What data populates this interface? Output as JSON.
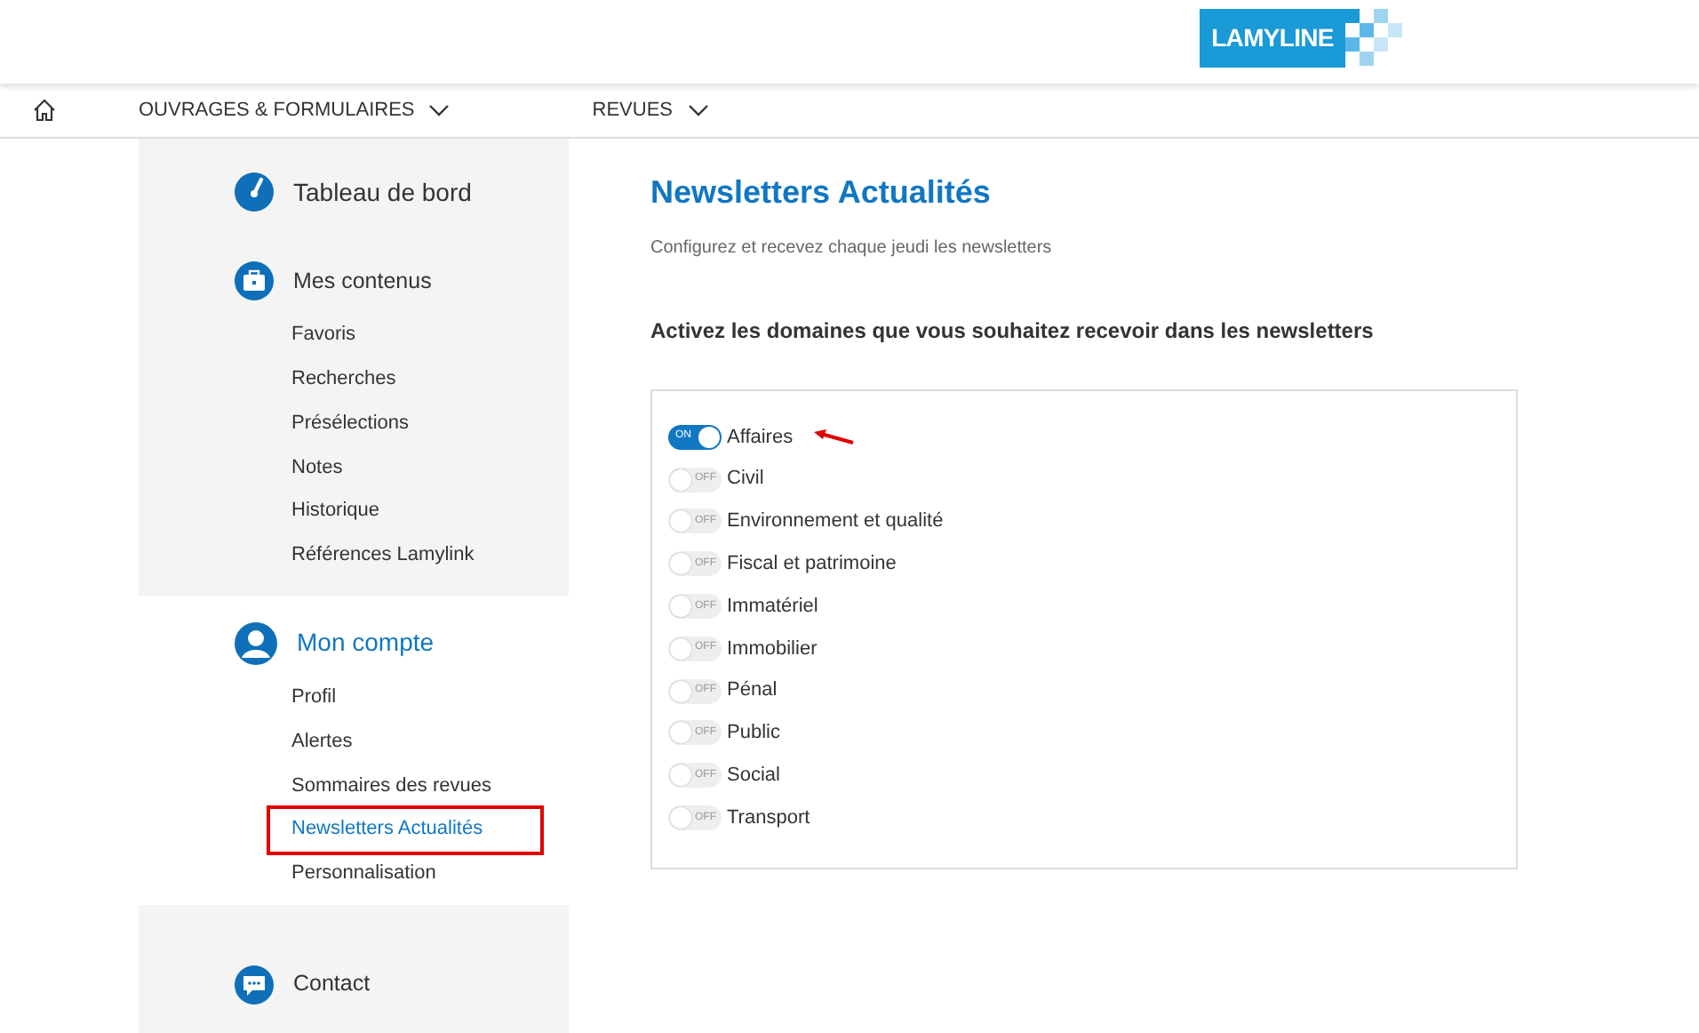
{
  "logo": {
    "text": "LAMYLINE"
  },
  "nav": [
    {
      "label": "OUVRAGES & FORMULAIRES",
      "dropdown": true
    },
    {
      "label": "REVUES",
      "dropdown": true
    }
  ],
  "sidebar": {
    "sections": [
      {
        "kind": "dashboard",
        "title": "Tableau de bord",
        "selected": false
      },
      {
        "kind": "briefcase",
        "title": "Mes contenus",
        "selected": false,
        "items": [
          {
            "label": "Favoris",
            "selected": false
          },
          {
            "label": "Recherches",
            "selected": false
          },
          {
            "label": "Présélections",
            "selected": false
          },
          {
            "label": "Notes",
            "selected": false
          },
          {
            "label": "Historique",
            "selected": false
          },
          {
            "label": "Références Lamylink",
            "selected": false
          }
        ]
      },
      {
        "kind": "user",
        "title": "Mon compte",
        "selected": true,
        "items": [
          {
            "label": "Profil",
            "selected": false
          },
          {
            "label": "Alertes",
            "selected": false
          },
          {
            "label": "Sommaires des revues",
            "selected": false
          },
          {
            "label": "Newsletters Actualités",
            "selected": true
          },
          {
            "label": "Personnalisation",
            "selected": false
          }
        ]
      },
      {
        "kind": "chat",
        "title": "Contact",
        "selected": false
      }
    ]
  },
  "main": {
    "title": "Newsletters Actualités",
    "subtitle": "Configurez et recevez chaque jeudi les newsletters",
    "heading": "Activez les domaines que vous souhaitez recevoir dans les newsletters",
    "domains": [
      {
        "label": "Affaires",
        "on": true,
        "switch_text": "ON",
        "pointed": true
      },
      {
        "label": "Civil",
        "on": false,
        "switch_text": "OFF",
        "pointed": false
      },
      {
        "label": "Environnement et qualité",
        "on": false,
        "switch_text": "OFF",
        "pointed": false
      },
      {
        "label": "Fiscal et patrimoine",
        "on": false,
        "switch_text": "OFF",
        "pointed": false
      },
      {
        "label": "Immatériel",
        "on": false,
        "switch_text": "OFF",
        "pointed": false
      },
      {
        "label": "Immobilier",
        "on": false,
        "switch_text": "OFF",
        "pointed": false
      },
      {
        "label": "Pénal",
        "on": false,
        "switch_text": "OFF",
        "pointed": false
      },
      {
        "label": "Public",
        "on": false,
        "switch_text": "OFF",
        "pointed": false
      },
      {
        "label": "Social",
        "on": false,
        "switch_text": "OFF",
        "pointed": false
      },
      {
        "label": "Transport",
        "on": false,
        "switch_text": "OFF",
        "pointed": false
      }
    ]
  }
}
